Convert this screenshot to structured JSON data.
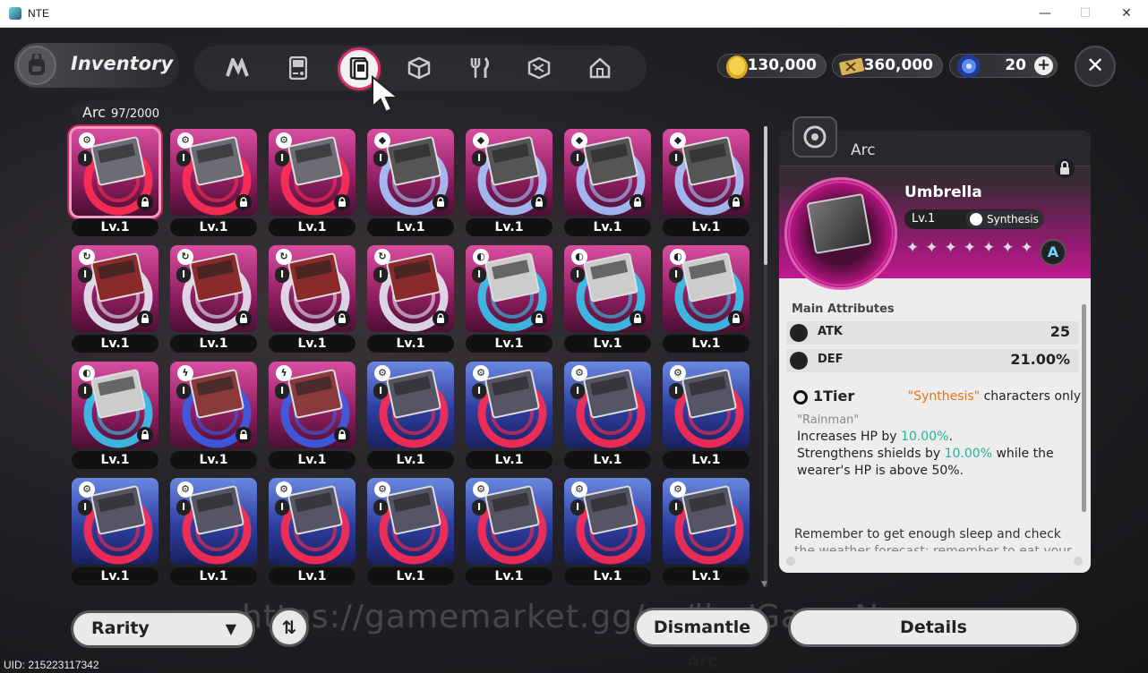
{
  "window": {
    "title": "NTE",
    "minimize": "—",
    "maximize": "☐",
    "close": "✕"
  },
  "header": {
    "title": "Inventory",
    "tabs": [
      {
        "name": "tab-arc-shards",
        "icon": "n-logo-icon"
      },
      {
        "name": "tab-devices",
        "icon": "gameboy-icon"
      },
      {
        "name": "tab-arc",
        "icon": "arc-card-icon",
        "active": true
      },
      {
        "name": "tab-materials",
        "icon": "cube-icon"
      },
      {
        "name": "tab-food",
        "icon": "fork-knife-icon"
      },
      {
        "name": "tab-items",
        "icon": "box-icon"
      },
      {
        "name": "tab-furniture",
        "icon": "house-icon"
      }
    ],
    "currencies": [
      {
        "name": "gold-currency",
        "icon": "coin-icon",
        "value": "130,000"
      },
      {
        "name": "ticket-currency",
        "icon": "ticket-icon",
        "value": "360,000"
      },
      {
        "name": "crystal-currency",
        "icon": "crystal-icon",
        "value": "20"
      }
    ],
    "close_label": "✕"
  },
  "inventory": {
    "category": "Arc",
    "count": "97/2000",
    "level_label": "Lv.1",
    "tier_label": "I",
    "rows": [
      [
        "rainman",
        "rainman",
        "rainman",
        "blue-card",
        "blue-card",
        "blue-card",
        "blue-card"
      ],
      [
        "red-swirl",
        "red-swirl",
        "red-swirl",
        "red-swirl",
        "cyan-wave",
        "cyan-wave",
        "cyan-wave"
      ],
      [
        "cyan-wave",
        "lightning",
        "lightning",
        "blue-ring",
        "blue-ring",
        "blue-ring",
        "blue-ring"
      ],
      [
        "blue-ring",
        "blue-ring",
        "blue-ring",
        "blue-ring",
        "blue-ring",
        "blue-ring",
        "blue-ring"
      ]
    ]
  },
  "detail": {
    "type": "Arc",
    "name": "Umbrella",
    "level": "Lv.1",
    "group": "Synthesis",
    "stars": "✦✦✦✦✦✦✦",
    "rank": "A",
    "main_attr_header": "Main Attributes",
    "attrs": [
      {
        "name": "ATK",
        "value": "25"
      },
      {
        "name": "DEF",
        "value": "21.00%"
      }
    ],
    "tier": "1Tier",
    "restriction_hi": "\"Synthesis\"",
    "restriction_rest": " characters only",
    "quote": "\"Rainman\"",
    "effect1_pre": "Increases HP by ",
    "effect1_val": "10.00%",
    "effect1_post": ".",
    "effect2_pre": "Strengthens shields by ",
    "effect2_val": "10.00%",
    "effect2_post": " while the",
    "effect3": "wearer's HP is above 50%.",
    "flavor": "Remember to get enough sleep and check",
    "flavor2": "the weather forecast; remember to eat your"
  },
  "bottom": {
    "rarity_label": "Rarity",
    "sort_label": "⇅",
    "dismantle_label": "Dismantle Arc",
    "details_label": "Details",
    "watermark": "https://gamemarket.gg/sy/lbs/GameNews"
  },
  "uid": "UID: 215223117342",
  "colors": {
    "accent": "#d82e6a",
    "pink_card": "#c0246e",
    "blue_card": "#3346a8",
    "green_value": "#1fb591",
    "orange": "#e2751c"
  }
}
